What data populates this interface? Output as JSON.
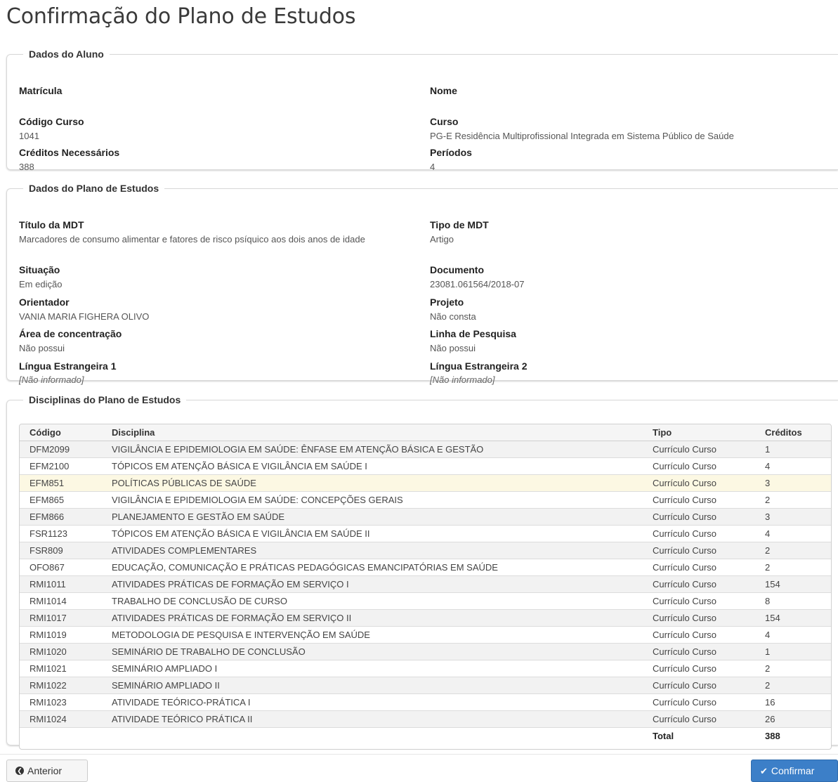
{
  "page": {
    "title": "Confirmação do Plano de Estudos"
  },
  "aluno": {
    "legend": "Dados do Aluno",
    "matricula_label": "Matrícula",
    "matricula_value": "",
    "nome_label": "Nome",
    "nome_value": "",
    "codigo_curso_label": "Código Curso",
    "codigo_curso_value": "1041",
    "curso_label": "Curso",
    "curso_value": "PG-E Residência Multiprofissional Integrada em Sistema Público de Saúde",
    "creditos_label": "Créditos Necessários",
    "creditos_value": "388",
    "periodos_label": "Períodos",
    "periodos_value": "4"
  },
  "plano": {
    "legend": "Dados do Plano de Estudos",
    "titulo_label": "Título da MDT",
    "titulo_value": "Marcadores de consumo alimentar e fatores de risco psíquico aos dois anos de idade",
    "tipo_label": "Tipo de MDT",
    "tipo_value": "Artigo",
    "situacao_label": "Situação",
    "situacao_value": "Em edição",
    "documento_label": "Documento",
    "documento_value": "23081.061564/2018-07",
    "orientador_label": "Orientador",
    "orientador_value": "VANIA MARIA FIGHERA OLIVO",
    "projeto_label": "Projeto",
    "projeto_value": "Não consta",
    "area_label": "Área de concentração",
    "area_value": "Não possui",
    "linha_label": "Linha de Pesquisa",
    "linha_value": "Não possui",
    "lingua1_label": "Língua Estrangeira 1",
    "lingua1_value": "[Não informado]",
    "lingua2_label": "Língua Estrangeira 2",
    "lingua2_value": "[Não informado]"
  },
  "disciplinas": {
    "legend": "Disciplinas do Plano de Estudos",
    "columns": [
      "Código",
      "Disciplina",
      "Tipo",
      "Créditos"
    ],
    "rows": [
      [
        "DFM2099",
        "VIGILÂNCIA E EPIDEMIOLOGIA EM SAÚDE: ÊNFASE EM ATENÇÃO BÁSICA E GESTÃO",
        "Currículo Curso",
        "1"
      ],
      [
        "EFM2100",
        "TÓPICOS EM ATENÇÃO BÁSICA E VIGILÂNCIA EM SAÚDE I",
        "Currículo Curso",
        "4"
      ],
      [
        "EFM851",
        "POLÍTICAS PÚBLICAS DE SAÚDE",
        "Currículo Curso",
        "3"
      ],
      [
        "EFM865",
        "VIGILÂNCIA E EPIDEMIOLOGIA EM SAÚDE: CONCEPÇÕES GERAIS",
        "Currículo Curso",
        "2"
      ],
      [
        "EFM866",
        "PLANEJAMENTO E GESTÃO EM SAÚDE",
        "Currículo Curso",
        "3"
      ],
      [
        "FSR1123",
        "TÓPICOS EM ATENÇÃO BÁSICA E VIGILÂNCIA EM SAÚDE II",
        "Currículo Curso",
        "4"
      ],
      [
        "FSR809",
        "ATIVIDADES COMPLEMENTARES",
        "Currículo Curso",
        "2"
      ],
      [
        "OFO867",
        "EDUCAÇÃO, COMUNICAÇÃO E PRÁTICAS PEDAGÓGICAS EMANCIPATÓRIAS EM SAÚDE",
        "Currículo Curso",
        "2"
      ],
      [
        "RMI1011",
        "ATIVIDADES PRÁTICAS DE FORMAÇÃO EM SERVIÇO I",
        "Currículo Curso",
        "154"
      ],
      [
        "RMI1014",
        "TRABALHO DE CONCLUSÃO DE CURSO",
        "Currículo Curso",
        "8"
      ],
      [
        "RMI1017",
        "ATIVIDADES PRÁTICAS DE FORMAÇÃO EM SERVIÇO II",
        "Currículo Curso",
        "154"
      ],
      [
        "RMI1019",
        "METODOLOGIA DE PESQUISA E INTERVENÇÃO EM SAÚDE",
        "Currículo Curso",
        "4"
      ],
      [
        "RMI1020",
        "SEMINÁRIO DE TRABALHO DE CONCLUSÃO",
        "Currículo Curso",
        "1"
      ],
      [
        "RMI1021",
        "SEMINÁRIO AMPLIADO I",
        "Currículo Curso",
        "2"
      ],
      [
        "RMI1022",
        "SEMINÁRIO AMPLIADO II",
        "Currículo Curso",
        "2"
      ],
      [
        "RMI1023",
        "ATIVIDADE TEÓRICO-PRÁTICA I",
        "Currículo Curso",
        "16"
      ],
      [
        "RMI1024",
        "ATIVIDADE TEÓRICO PRÁTICA II",
        "Currículo Curso",
        "26"
      ]
    ],
    "highlight_row": 2,
    "total_label": "Total",
    "total_value": "388"
  },
  "actions": {
    "prev_label": "Anterior",
    "prev_icon": "circle-arrow-left-icon",
    "confirm_label": "Confirmar",
    "confirm_icon": "check-icon",
    "confirm_color": "#3c7fc8"
  }
}
